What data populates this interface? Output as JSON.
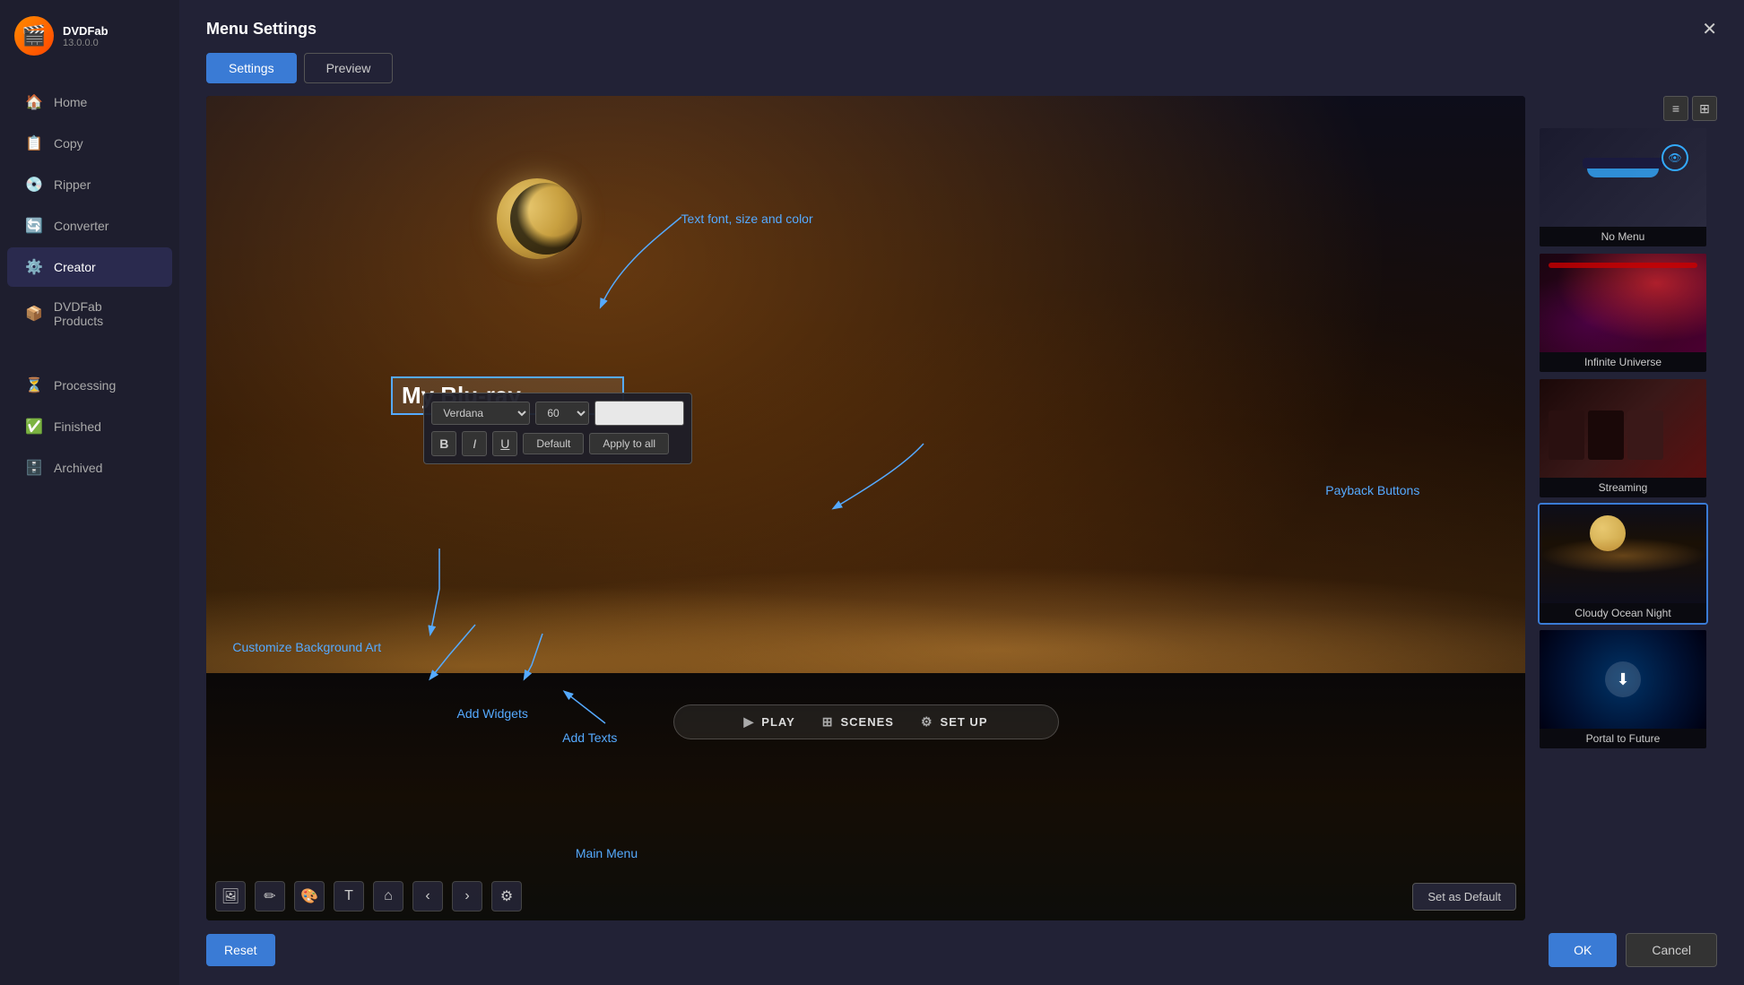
{
  "app": {
    "name": "DVDFab",
    "version": "13.0.0.0"
  },
  "sidebar": {
    "items": [
      {
        "id": "home",
        "label": "Home",
        "icon": "🏠",
        "active": false
      },
      {
        "id": "copy",
        "label": "Copy",
        "icon": "📋",
        "active": false
      },
      {
        "id": "ripper",
        "label": "Ripper",
        "icon": "💿",
        "active": false
      },
      {
        "id": "converter",
        "label": "Converter",
        "icon": "🔄",
        "active": false
      },
      {
        "id": "creator",
        "label": "Creator",
        "icon": "⚙️",
        "active": true
      },
      {
        "id": "dvdfab-products",
        "label": "DVDFab Products",
        "icon": "📦",
        "active": false
      }
    ],
    "status_items": [
      {
        "id": "processing",
        "label": "Processing",
        "icon": "⏳"
      },
      {
        "id": "finished",
        "label": "Finished",
        "icon": "✅"
      },
      {
        "id": "archived",
        "label": "Archived",
        "icon": "🗄️"
      }
    ]
  },
  "dialog": {
    "title": "Menu Settings",
    "close_label": "✕",
    "tabs": [
      {
        "id": "settings",
        "label": "Settings",
        "active": true
      },
      {
        "id": "preview",
        "label": "Preview",
        "active": false
      }
    ]
  },
  "canvas": {
    "title_placeholder": "My Blu-ray",
    "font_family": "Verdana",
    "font_size": "60",
    "bold_label": "B",
    "italic_label": "I",
    "underline_label": "U",
    "default_btn": "Default",
    "apply_all_btn": "Apply to all",
    "playback_buttons": [
      {
        "icon": "▶",
        "label": "PLAY"
      },
      {
        "icon": "⊞",
        "label": "SCENES"
      },
      {
        "icon": "⚙",
        "label": "SET UP"
      }
    ],
    "set_default_btn": "Set as Default",
    "annotations": {
      "text_font": "Text font, size and color",
      "payback_buttons": "Payback Buttons",
      "customize_bg": "Customize Background Art",
      "add_widgets": "Add Widgets",
      "add_texts": "Add Texts",
      "main_menu": "Main Menu"
    }
  },
  "themes": [
    {
      "id": "no-menu",
      "label": "No Menu",
      "selected": false,
      "style": "no-menu"
    },
    {
      "id": "infinite-universe",
      "label": "Infinite Universe",
      "selected": false,
      "style": "infinite"
    },
    {
      "id": "streaming",
      "label": "Streaming",
      "selected": false,
      "style": "streaming"
    },
    {
      "id": "cloudy-ocean-night",
      "label": "Cloudy Ocean Night",
      "selected": true,
      "style": "ocean"
    },
    {
      "id": "portal-to-future",
      "label": "Portal to Future",
      "selected": false,
      "style": "portal"
    }
  ],
  "footer": {
    "reset_label": "Reset",
    "ok_label": "OK",
    "cancel_label": "Cancel"
  }
}
